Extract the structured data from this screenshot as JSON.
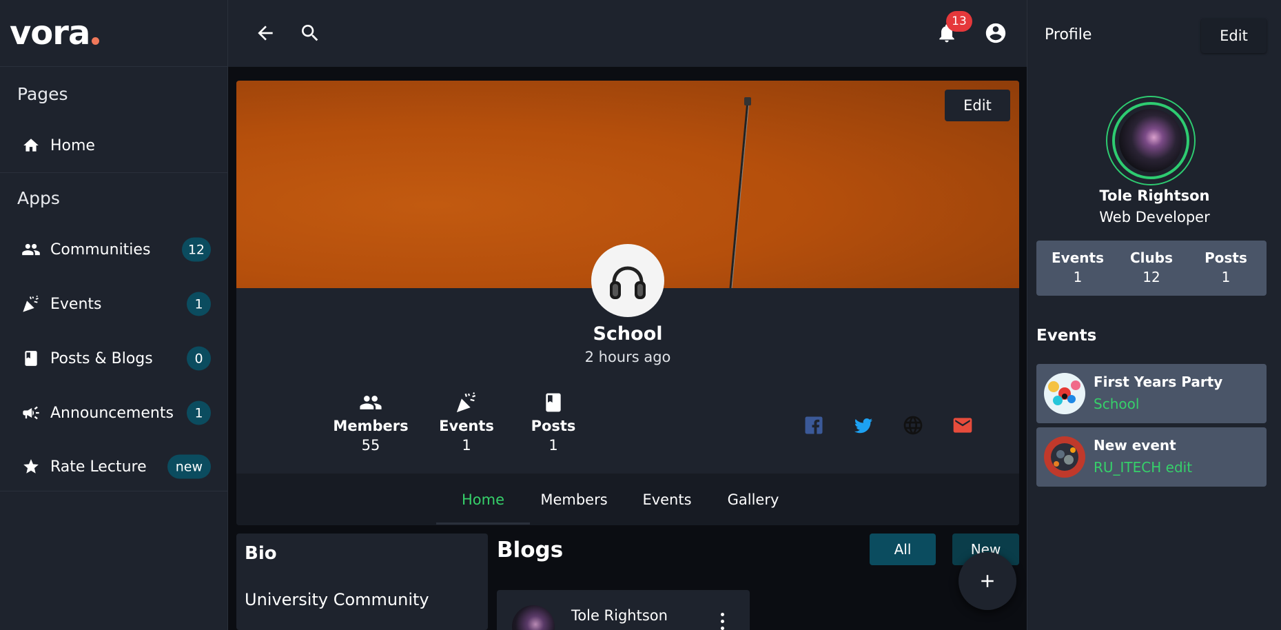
{
  "brand": {
    "logo": "vora",
    "accent": "#f0785a"
  },
  "sidebar": {
    "pages_title": "Pages",
    "apps_title": "Apps",
    "pages": [
      {
        "label": "Home",
        "icon": "home-icon"
      }
    ],
    "apps": [
      {
        "label": "Communities",
        "icon": "people-icon",
        "badge": "12"
      },
      {
        "label": "Events",
        "icon": "party-icon",
        "badge": "1"
      },
      {
        "label": "Posts & Blogs",
        "icon": "book-icon",
        "badge": "0"
      },
      {
        "label": "Announcements",
        "icon": "megaphone-icon",
        "badge": "1"
      },
      {
        "label": "Rate Lecture",
        "icon": "star-icon",
        "badge": "new"
      }
    ]
  },
  "topbar": {
    "notifications_count": "13"
  },
  "community": {
    "edit_label": "Edit",
    "name": "School",
    "time": "2 hours ago",
    "stats": [
      {
        "label": "Members",
        "value": "55",
        "icon": "people-icon"
      },
      {
        "label": "Events",
        "value": "1",
        "icon": "party-icon"
      },
      {
        "label": "Posts",
        "value": "1",
        "icon": "book-icon"
      }
    ],
    "social": [
      {
        "icon": "facebook-icon",
        "color": "#3b5998"
      },
      {
        "icon": "twitter-icon",
        "color": "#1da1f2"
      },
      {
        "icon": "globe-icon",
        "color": "#111111"
      },
      {
        "icon": "mail-icon",
        "color": "#e74c3c"
      }
    ],
    "tabs": [
      "Home",
      "Members",
      "Events",
      "Gallery"
    ],
    "active_tab": "Home"
  },
  "bio": {
    "title": "Bio",
    "text": "University Community"
  },
  "blogs": {
    "title": "Blogs",
    "all_label": "All",
    "new_label": "New",
    "posts": [
      {
        "author": "Tole Rightson"
      }
    ]
  },
  "profile": {
    "title": "Profile",
    "edit_label": "Edit",
    "name": "Tole Rightson",
    "role": "Web Developer",
    "stats": [
      {
        "label": "Events",
        "value": "1"
      },
      {
        "label": "Clubs",
        "value": "12"
      },
      {
        "label": "Posts",
        "value": "1"
      }
    ],
    "events_title": "Events",
    "events": [
      {
        "name": "First Years Party",
        "community": "School"
      },
      {
        "name": "New event",
        "community": "RU_ITECH edit"
      }
    ]
  },
  "colors": {
    "active": "#36d06a",
    "badge_bg": "#0b4c5f",
    "notification": "#e5383b"
  }
}
